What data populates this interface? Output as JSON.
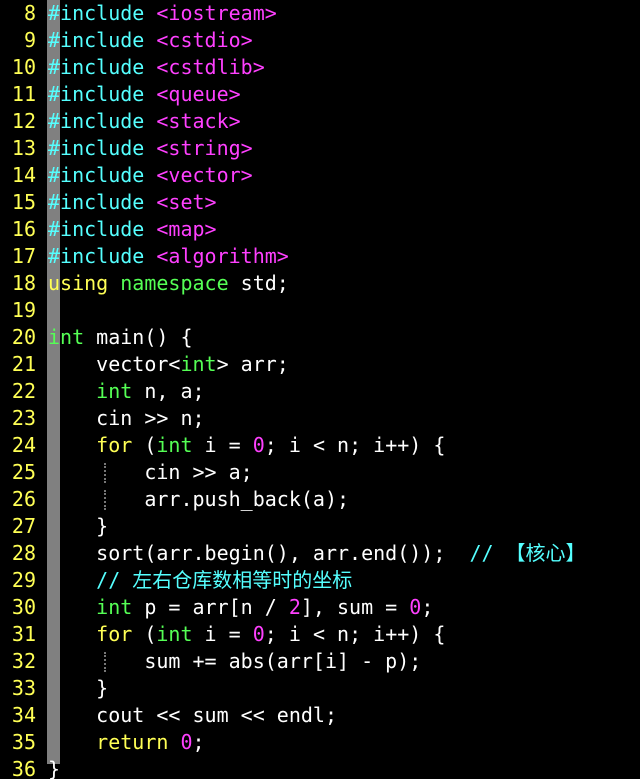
{
  "editor": {
    "lines": [
      {
        "num": "8",
        "tokens": [
          {
            "t": "#include",
            "c": "k-pre"
          },
          {
            "t": " ",
            "c": "k-plain"
          },
          {
            "t": "<iostream>",
            "c": "k-inc"
          }
        ]
      },
      {
        "num": "9",
        "tokens": [
          {
            "t": "#include",
            "c": "k-pre"
          },
          {
            "t": " ",
            "c": "k-plain"
          },
          {
            "t": "<cstdio>",
            "c": "k-inc"
          }
        ]
      },
      {
        "num": "10",
        "tokens": [
          {
            "t": "#include",
            "c": "k-pre"
          },
          {
            "t": " ",
            "c": "k-plain"
          },
          {
            "t": "<cstdlib>",
            "c": "k-inc"
          }
        ]
      },
      {
        "num": "11",
        "tokens": [
          {
            "t": "#include",
            "c": "k-pre"
          },
          {
            "t": " ",
            "c": "k-plain"
          },
          {
            "t": "<queue>",
            "c": "k-inc"
          }
        ]
      },
      {
        "num": "12",
        "tokens": [
          {
            "t": "#include",
            "c": "k-pre"
          },
          {
            "t": " ",
            "c": "k-plain"
          },
          {
            "t": "<stack>",
            "c": "k-inc"
          }
        ]
      },
      {
        "num": "13",
        "tokens": [
          {
            "t": "#include",
            "c": "k-pre"
          },
          {
            "t": " ",
            "c": "k-plain"
          },
          {
            "t": "<string>",
            "c": "k-inc"
          }
        ]
      },
      {
        "num": "14",
        "tokens": [
          {
            "t": "#include",
            "c": "k-pre"
          },
          {
            "t": " ",
            "c": "k-plain"
          },
          {
            "t": "<vector>",
            "c": "k-inc"
          }
        ]
      },
      {
        "num": "15",
        "tokens": [
          {
            "t": "#include",
            "c": "k-pre"
          },
          {
            "t": " ",
            "c": "k-plain"
          },
          {
            "t": "<set>",
            "c": "k-inc"
          }
        ]
      },
      {
        "num": "16",
        "tokens": [
          {
            "t": "#include",
            "c": "k-pre"
          },
          {
            "t": " ",
            "c": "k-plain"
          },
          {
            "t": "<map>",
            "c": "k-inc"
          }
        ]
      },
      {
        "num": "17",
        "tokens": [
          {
            "t": "#include",
            "c": "k-pre"
          },
          {
            "t": " ",
            "c": "k-plain"
          },
          {
            "t": "<algorithm>",
            "c": "k-inc"
          }
        ]
      },
      {
        "num": "18",
        "tokens": [
          {
            "t": "using",
            "c": "k-kw"
          },
          {
            "t": " ",
            "c": "k-plain"
          },
          {
            "t": "namespace",
            "c": "k-type"
          },
          {
            "t": " std;",
            "c": "k-plain"
          }
        ]
      },
      {
        "num": "19",
        "tokens": []
      },
      {
        "num": "20",
        "tokens": [
          {
            "t": "int",
            "c": "k-type"
          },
          {
            "t": " main() {",
            "c": "k-plain"
          }
        ]
      },
      {
        "num": "21",
        "tokens": [
          {
            "t": "    vector<",
            "c": "k-plain"
          },
          {
            "t": "int",
            "c": "k-type"
          },
          {
            "t": "> arr;",
            "c": "k-plain"
          }
        ]
      },
      {
        "num": "22",
        "tokens": [
          {
            "t": "    ",
            "c": "k-plain"
          },
          {
            "t": "int",
            "c": "k-type"
          },
          {
            "t": " n, a;",
            "c": "k-plain"
          }
        ]
      },
      {
        "num": "23",
        "tokens": [
          {
            "t": "    cin >> n;",
            "c": "k-plain"
          }
        ]
      },
      {
        "num": "24",
        "tokens": [
          {
            "t": "    ",
            "c": "k-plain"
          },
          {
            "t": "for",
            "c": "k-kw"
          },
          {
            "t": " (",
            "c": "k-plain"
          },
          {
            "t": "int",
            "c": "k-type"
          },
          {
            "t": " i = ",
            "c": "k-plain"
          },
          {
            "t": "0",
            "c": "k-num"
          },
          {
            "t": "; i < n; i++) {",
            "c": "k-plain"
          }
        ]
      },
      {
        "num": "25",
        "guide": true,
        "tokens": [
          {
            "t": "        cin >> a;",
            "c": "k-plain"
          }
        ]
      },
      {
        "num": "26",
        "guide": true,
        "tokens": [
          {
            "t": "        arr.push_back(a);",
            "c": "k-plain"
          }
        ]
      },
      {
        "num": "27",
        "tokens": [
          {
            "t": "    }",
            "c": "k-plain"
          }
        ]
      },
      {
        "num": "28",
        "tokens": [
          {
            "t": "    sort(arr.begin(), arr.end());  ",
            "c": "k-plain"
          },
          {
            "t": "// 【核心】",
            "c": "k-cmt"
          }
        ]
      },
      {
        "num": "29",
        "tokens": [
          {
            "t": "    ",
            "c": "k-plain"
          },
          {
            "t": "// 左右仓库数相等时的坐标",
            "c": "k-cmt"
          }
        ]
      },
      {
        "num": "30",
        "tokens": [
          {
            "t": "    ",
            "c": "k-plain"
          },
          {
            "t": "int",
            "c": "k-type"
          },
          {
            "t": " p = arr[n / ",
            "c": "k-plain"
          },
          {
            "t": "2",
            "c": "k-num"
          },
          {
            "t": "], sum = ",
            "c": "k-plain"
          },
          {
            "t": "0",
            "c": "k-num"
          },
          {
            "t": ";",
            "c": "k-plain"
          }
        ]
      },
      {
        "num": "31",
        "tokens": [
          {
            "t": "    ",
            "c": "k-plain"
          },
          {
            "t": "for",
            "c": "k-kw"
          },
          {
            "t": " (",
            "c": "k-plain"
          },
          {
            "t": "int",
            "c": "k-type"
          },
          {
            "t": " i = ",
            "c": "k-plain"
          },
          {
            "t": "0",
            "c": "k-num"
          },
          {
            "t": "; i < n; i++) {",
            "c": "k-plain"
          }
        ]
      },
      {
        "num": "32",
        "guide": true,
        "tokens": [
          {
            "t": "        sum += abs(arr[i] - p);",
            "c": "k-plain"
          }
        ]
      },
      {
        "num": "33",
        "tokens": [
          {
            "t": "    }",
            "c": "k-plain"
          }
        ]
      },
      {
        "num": "34",
        "tokens": [
          {
            "t": "    cout << sum << endl;",
            "c": "k-plain"
          }
        ]
      },
      {
        "num": "35",
        "tokens": [
          {
            "t": "    ",
            "c": "k-plain"
          },
          {
            "t": "return",
            "c": "k-kw"
          },
          {
            "t": " ",
            "c": "k-plain"
          },
          {
            "t": "0",
            "c": "k-num"
          },
          {
            "t": ";",
            "c": "k-plain"
          }
        ]
      },
      {
        "num": "36",
        "tokens": [
          {
            "t": "}",
            "c": "k-plain"
          }
        ]
      }
    ]
  }
}
